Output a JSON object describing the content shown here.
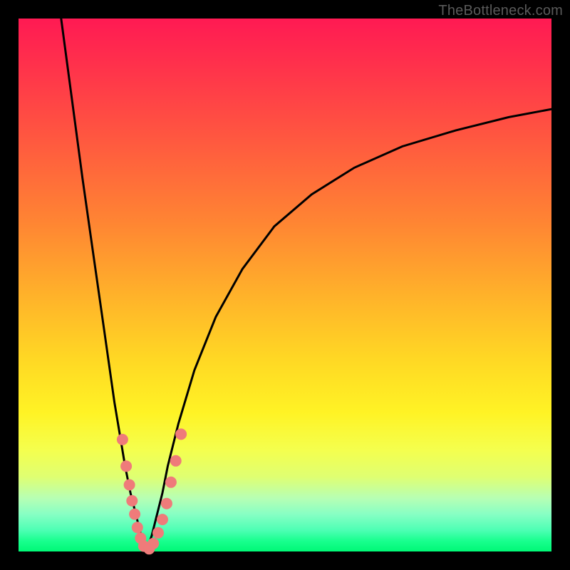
{
  "watermark": "TheBottleneck.com",
  "colors": {
    "frame": "#000000",
    "curve": "#000000",
    "marker_fill": "#ef7b7a",
    "gradient_stops": [
      "#ff1a53",
      "#ff8433",
      "#fff325",
      "#00f876"
    ]
  },
  "chart_data": {
    "type": "line",
    "title": "",
    "xlabel": "",
    "ylabel": "",
    "xlim": [
      0,
      100
    ],
    "ylim": [
      0,
      100
    ],
    "grid": false,
    "annotations": [
      "TheBottleneck.com"
    ],
    "series": [
      {
        "name": "bottleneck-curve-left",
        "x": [
          8,
          10,
          12,
          14,
          16,
          18,
          19,
          20,
          21,
          22,
          23,
          24
        ],
        "y": [
          100,
          85,
          70,
          56,
          42,
          28,
          22,
          16,
          11,
          7,
          3,
          0
        ]
      },
      {
        "name": "bottleneck-curve-right",
        "x": [
          24,
          25,
          26,
          27,
          28,
          30,
          33,
          37,
          42,
          48,
          55,
          63,
          72,
          82,
          92,
          100
        ],
        "y": [
          0,
          3,
          7,
          11,
          16,
          24,
          34,
          44,
          53,
          61,
          67,
          72,
          76,
          79,
          81.5,
          83
        ]
      }
    ],
    "markers": {
      "name": "highlighted-points",
      "points": [
        {
          "x": 19.5,
          "y": 21
        },
        {
          "x": 20.2,
          "y": 16
        },
        {
          "x": 20.8,
          "y": 12.5
        },
        {
          "x": 21.3,
          "y": 9.5
        },
        {
          "x": 21.8,
          "y": 7
        },
        {
          "x": 22.3,
          "y": 4.5
        },
        {
          "x": 22.9,
          "y": 2.5
        },
        {
          "x": 23.5,
          "y": 1
        },
        {
          "x": 24.5,
          "y": 0.5
        },
        {
          "x": 25.3,
          "y": 1.5
        },
        {
          "x": 26.2,
          "y": 3.5
        },
        {
          "x": 27.0,
          "y": 6
        },
        {
          "x": 27.8,
          "y": 9
        },
        {
          "x": 28.6,
          "y": 13
        },
        {
          "x": 29.5,
          "y": 17
        },
        {
          "x": 30.5,
          "y": 22
        }
      ]
    }
  }
}
